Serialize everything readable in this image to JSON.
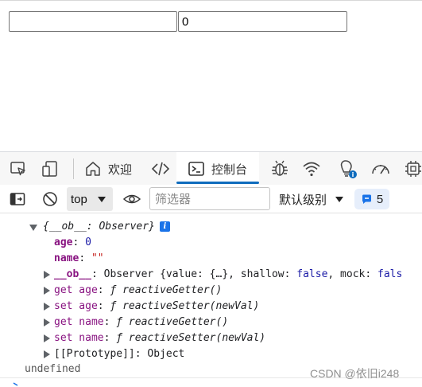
{
  "page": {
    "input1_value": "",
    "input2_value": "0"
  },
  "devtools": {
    "tabs": {
      "welcome": "欢迎",
      "console": "控制台"
    },
    "toolbar": {
      "context": "top",
      "filter_placeholder": "筛选器",
      "levels": "默认级别",
      "issues_count": "5"
    },
    "icons": {
      "accent": "#0f6cbd"
    }
  },
  "console": {
    "object_header": "{__ob__: Observer}",
    "props": [
      {
        "key": "age",
        "value": "0"
      },
      {
        "key": "name",
        "value": "\"\""
      }
    ],
    "ob_line": {
      "key": "__ob__",
      "value_prefix": "Observer {value: {…}, shallow: ",
      "shallow": "false",
      "mock_label": ", mock: ",
      "mock": "fals"
    },
    "accessors": [
      {
        "kind": "get age",
        "fn": "ƒ reactiveGetter()"
      },
      {
        "kind": "set age",
        "fn": "ƒ reactiveSetter(newVal)"
      },
      {
        "kind": "get name",
        "fn": "ƒ reactiveGetter()"
      },
      {
        "kind": "set name",
        "fn": "ƒ reactiveSetter(newVal)"
      }
    ],
    "prototype": {
      "key": "[[Prototype]]",
      "value": "Object"
    },
    "result": "undefined"
  },
  "watermark": "CSDN @依旧i248"
}
